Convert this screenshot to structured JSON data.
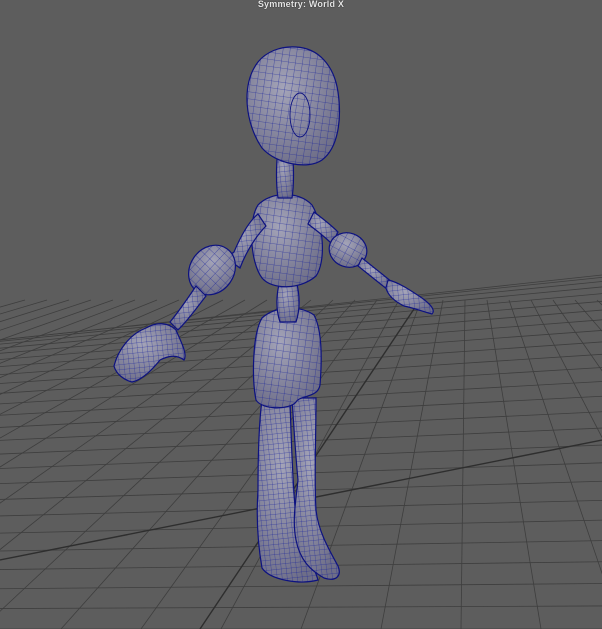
{
  "viewport": {
    "hud_title": "Symmetry: World X",
    "background_color": "#5d5d5d",
    "grid_color": "#3e3e3e",
    "grid_axis_color": "#2e2e2e",
    "wireframe_color": "#101a9a",
    "mesh_color": "#8b8ba0"
  },
  "scene": {
    "object": "humanoid-character-mesh",
    "display_mode": "wireframe-on-shaded"
  }
}
